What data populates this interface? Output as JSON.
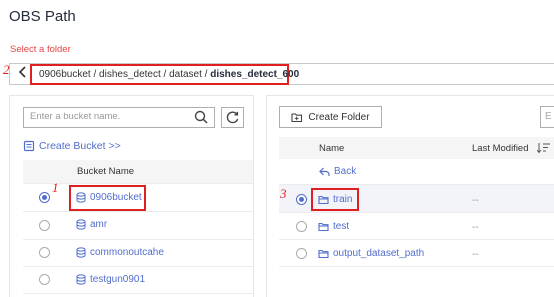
{
  "header": {
    "title": "OBS Path",
    "select_label": "Select a folder"
  },
  "path": {
    "prefix": "0906bucket / dishes_detect / dataset / ",
    "current": "dishes_detect_600"
  },
  "annotations": {
    "n1": "1",
    "n2": "2",
    "n3": "3"
  },
  "left": {
    "search_placeholder": "Enter a bucket name.",
    "create_bucket": "Create Bucket >>",
    "column_header": "Bucket Name",
    "buckets": [
      {
        "name": "0906bucket",
        "selected": true
      },
      {
        "name": "amr",
        "selected": false
      },
      {
        "name": "commonoutcahe",
        "selected": false
      },
      {
        "name": "testgun0901",
        "selected": false
      }
    ]
  },
  "right": {
    "create_folder": "Create Folder",
    "edge_button": "E",
    "columns": {
      "name": "Name",
      "last_modified": "Last Modified"
    },
    "back": "Back",
    "items": [
      {
        "name": "train",
        "modified": "--",
        "selected": true
      },
      {
        "name": "test",
        "modified": "--",
        "selected": false
      },
      {
        "name": "output_dataset_path",
        "modified": "--",
        "selected": false
      }
    ]
  },
  "colors": {
    "accent": "#526ecc",
    "annotation": "#e02020",
    "warning_text": "#e54545"
  }
}
